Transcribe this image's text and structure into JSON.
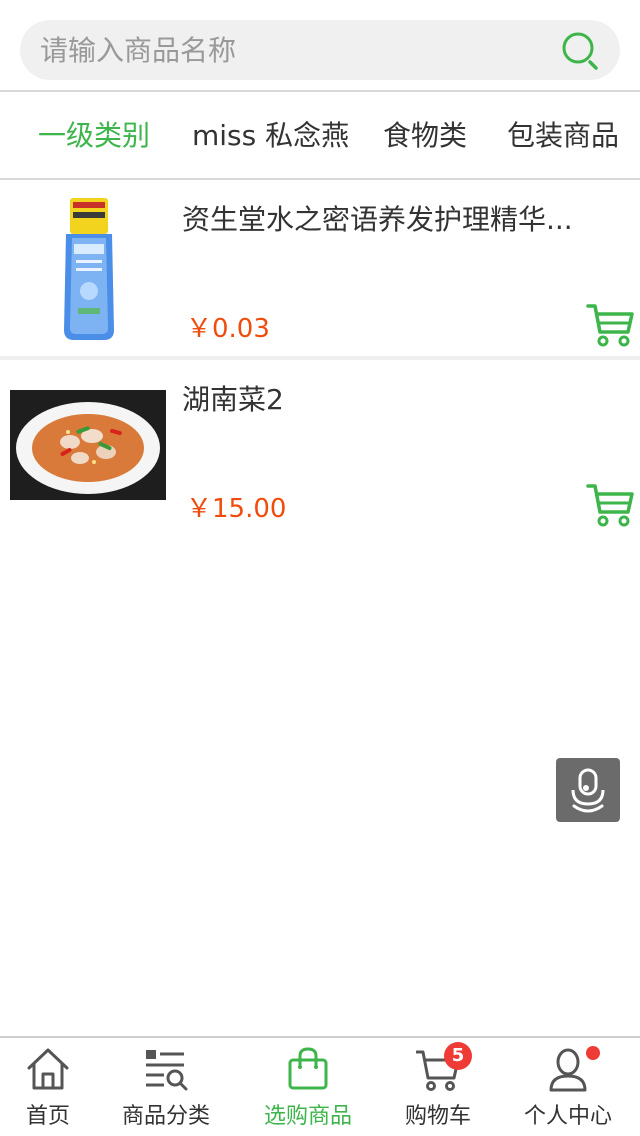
{
  "search": {
    "placeholder": "请输入商品名称",
    "value": ""
  },
  "categories": [
    {
      "label": "一级类别",
      "active": true
    },
    {
      "label": "miss 私念燕",
      "active": false
    },
    {
      "label": "食物类",
      "active": false
    },
    {
      "label": "包装商品",
      "active": false
    }
  ],
  "products": [
    {
      "name": "资生堂水之密语养发护理精华...",
      "price": "￥0.03"
    },
    {
      "name": "湖南菜2",
      "price": "￥15.00"
    }
  ],
  "tabbar": {
    "items": [
      {
        "label": "首页",
        "icon": "home-icon"
      },
      {
        "label": "商品分类",
        "icon": "category-list-icon"
      },
      {
        "label": "选购商品",
        "icon": "shopping-bag-icon",
        "active": true
      },
      {
        "label": "购物车",
        "icon": "cart-icon",
        "badge": "5"
      },
      {
        "label": "个人中心",
        "icon": "user-icon",
        "dot": true
      }
    ]
  },
  "colors": {
    "accent": "#3db54a",
    "price": "#ef4c0e",
    "badge": "#ee3b36"
  }
}
